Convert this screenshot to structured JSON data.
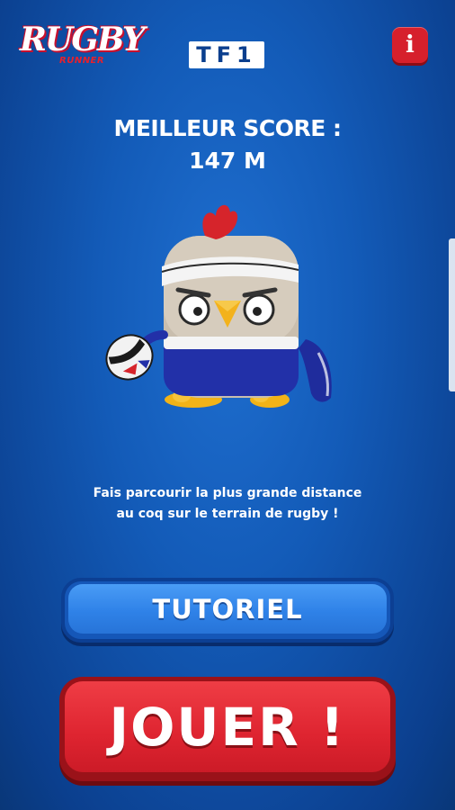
{
  "header": {
    "logo_main": "RUGBY",
    "logo_sub": "RUNNER",
    "channel": "TF1",
    "info_label": "i"
  },
  "score": {
    "label": "MEILLEUR SCORE :",
    "value": "147 M"
  },
  "instruction": {
    "line1": "Fais parcourir la plus grande distance",
    "line2": "au coq sur le terrain de rugby !"
  },
  "buttons": {
    "tutorial": "TUTORIEL",
    "play": "JOUER !"
  },
  "colors": {
    "background": "#135bb8",
    "tutorial_button": "#2f82e8",
    "play_button": "#de2430",
    "info_button": "#d6202c"
  }
}
